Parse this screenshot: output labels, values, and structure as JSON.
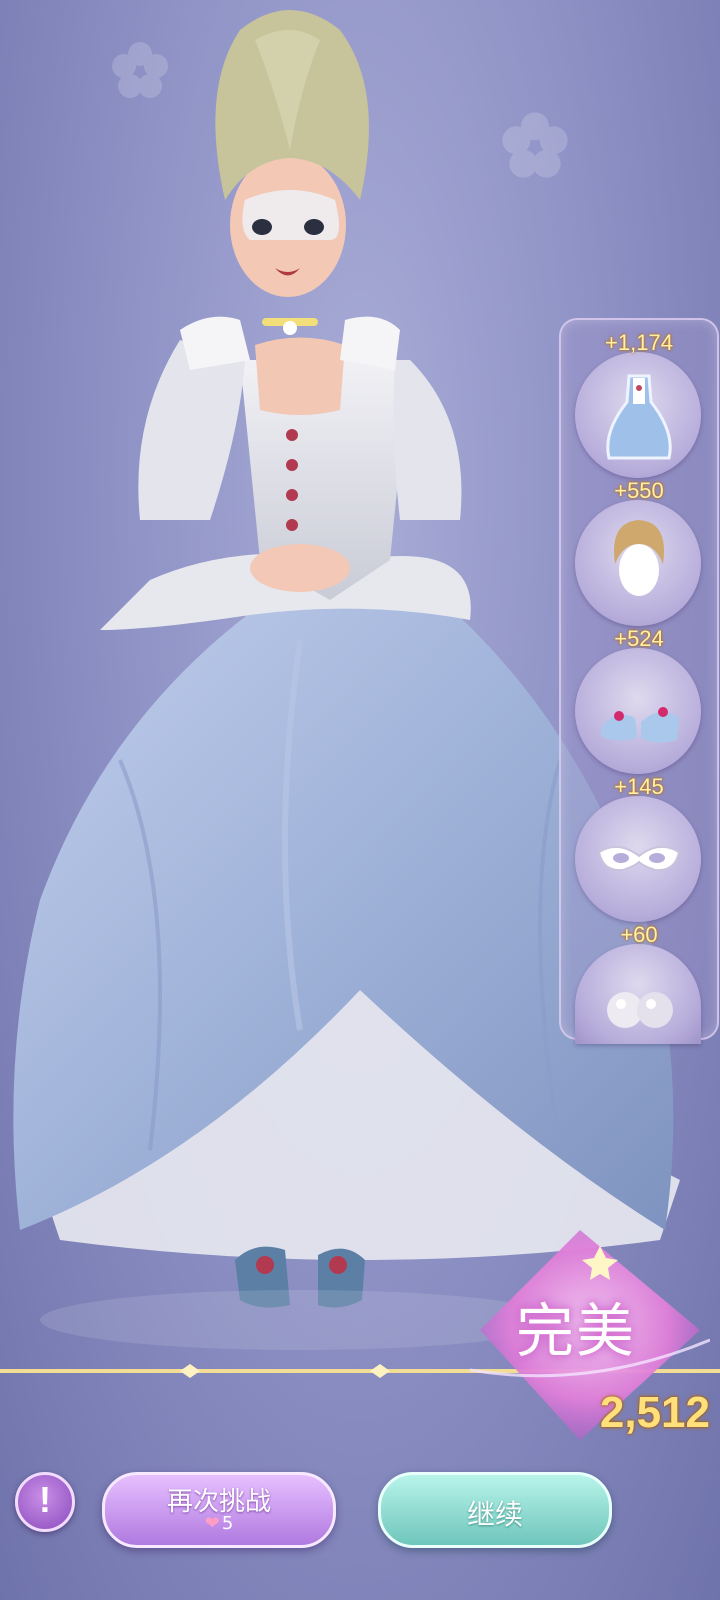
{
  "items": [
    {
      "points": "+1,174",
      "icon": "dress-icon"
    },
    {
      "points": "+550",
      "icon": "hairstyle-icon"
    },
    {
      "points": "+524",
      "icon": "shoes-icon"
    },
    {
      "points": "+145",
      "icon": "mask-icon"
    },
    {
      "points": "+60",
      "icon": "earrings-icon"
    }
  ],
  "result": {
    "rating": "完美",
    "total_score": "2,512"
  },
  "buttons": {
    "info": "!",
    "retry_label": "再次挑战",
    "retry_cost": "5",
    "continue_label": "继续"
  },
  "colors": {
    "background": "#8f93c6",
    "gown": "#9fb2d8",
    "accent_gold": "#ffe07a",
    "retry": "#c08ae6",
    "continue": "#7fd0c6"
  }
}
